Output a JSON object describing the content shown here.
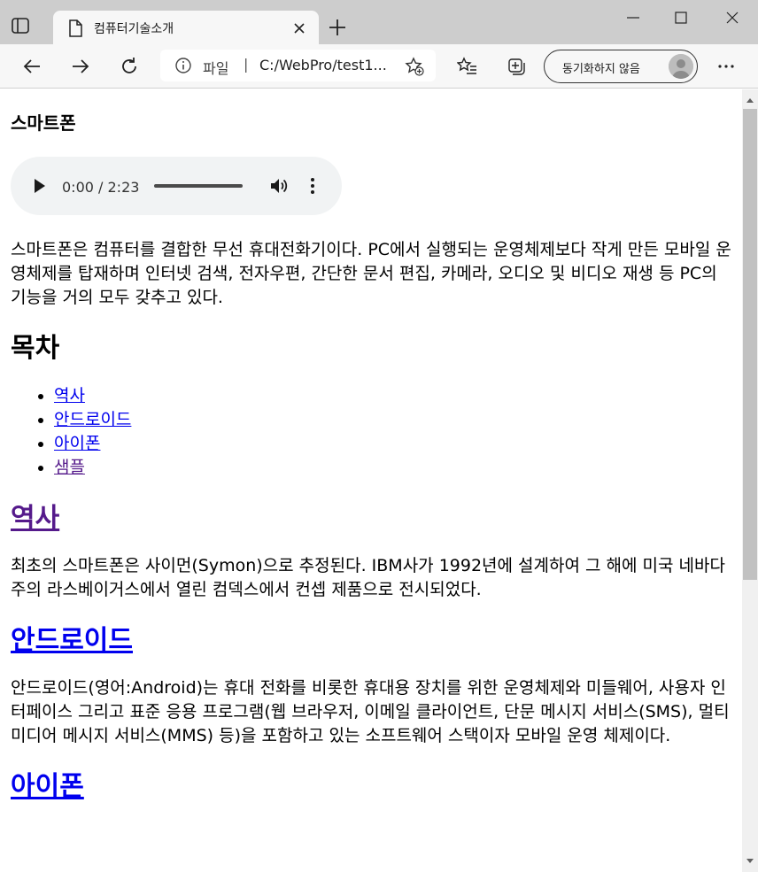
{
  "browser": {
    "tab_title": "컴퓨터기술소개",
    "address_scheme": "파일",
    "address_separator": "|",
    "address_url": "C:/WebPro/test1...",
    "sync_label": "동기화하지 않음"
  },
  "page": {
    "heading_smartphone": "스마트폰",
    "audio": {
      "time": "0:00 / 2:23"
    },
    "intro_paragraph": "스마트폰은 컴퓨터를 결합한 무선 휴대전화기이다. PC에서 실행되는 운영체제보다 작게 만든 모바일 운영체제를 탑재하며 인터넷 검색, 전자우편, 간단한 문서 편집, 카메라, 오디오 및 비디오 재생 등 PC의 기능을 거의 모두 갖추고 있다.",
    "toc_heading": "목차",
    "toc": [
      "역사",
      "안드로이드",
      "아이폰",
      "샘플"
    ],
    "section_history": {
      "title": "역사",
      "text": "최초의 스마트폰은 사이먼(Symon)으로 추정된다. IBM사가 1992년에 설계하여 그 해에 미국 네바다 주의 라스베이거스에서 열린 컴덱스에서 컨셉 제품으로 전시되었다."
    },
    "section_android": {
      "title": "안드로이드",
      "text": "안드로이드(영어:Android)는 휴대 전화를 비롯한 휴대용 장치를 위한 운영체제와 미들웨어, 사용자 인터페이스 그리고 표준 응용 프로그램(웹 브라우저, 이메일 클라이언트, 단문 메시지 서비스(SMS), 멀티미디어 메시지 서비스(MMS) 등)을 포함하고 있는 소프트웨어 스택이자 모바일 운영 체제이다."
    },
    "section_iphone": {
      "title": "아이폰"
    }
  },
  "colors": {
    "link": "#0000ee",
    "visited_link": "#551a8b",
    "titlebar": "#cdcdcd",
    "toolbar": "#f7f7f7"
  },
  "icons": {
    "tab_actions": "tab-actions-icon",
    "favicon": "document-icon",
    "close": "close-icon",
    "new_tab": "plus-icon",
    "back": "arrow-left-icon",
    "forward": "arrow-right-icon",
    "reload": "reload-icon",
    "info": "info-icon",
    "add_favorite": "star-plus-icon",
    "favorites": "favorites-list-icon",
    "collections": "collections-icon",
    "profile": "avatar",
    "more": "more-horizontal-icon"
  }
}
